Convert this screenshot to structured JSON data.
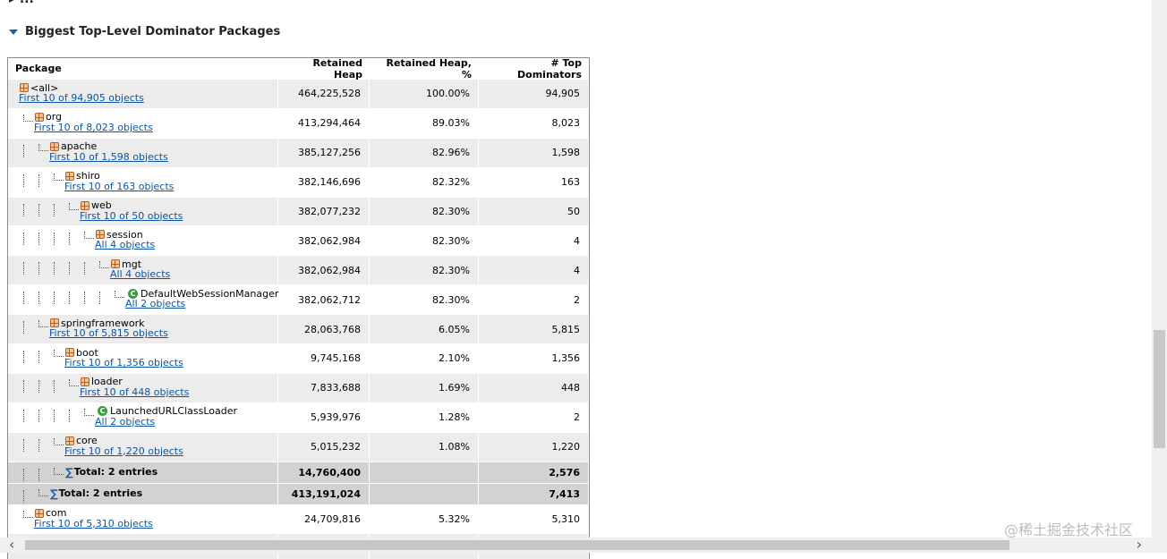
{
  "section": {
    "title": "Biggest Top-Level Dominator Packages"
  },
  "table": {
    "headers": [
      "Package",
      "Retained Heap",
      "Retained Heap, %",
      "# Top Dominators"
    ],
    "rows": [
      {
        "name": "<all>",
        "link": "First 10 of 94,905 objects",
        "heap": "464,225,528",
        "pct": "100.00%",
        "dom": "94,905",
        "depth": 0,
        "icon": "package",
        "shaded": true
      },
      {
        "name": "org",
        "link": "First 10 of 8,023 objects",
        "heap": "413,294,464",
        "pct": "89.03%",
        "dom": "8,023",
        "depth": 1,
        "icon": "package",
        "shaded": false
      },
      {
        "name": "apache",
        "link": "First 10 of 1,598 objects",
        "heap": "385,127,256",
        "pct": "82.96%",
        "dom": "1,598",
        "depth": 2,
        "icon": "package",
        "shaded": true
      },
      {
        "name": "shiro",
        "link": "First 10 of 163 objects",
        "heap": "382,146,696",
        "pct": "82.32%",
        "dom": "163",
        "depth": 3,
        "icon": "package",
        "shaded": false
      },
      {
        "name": "web",
        "link": "First 10 of 50 objects",
        "heap": "382,077,232",
        "pct": "82.30%",
        "dom": "50",
        "depth": 4,
        "icon": "package",
        "shaded": true
      },
      {
        "name": "session",
        "link": "All 4 objects",
        "heap": "382,062,984",
        "pct": "82.30%",
        "dom": "4",
        "depth": 5,
        "icon": "package",
        "shaded": false
      },
      {
        "name": "mgt",
        "link": "All 4 objects",
        "heap": "382,062,984",
        "pct": "82.30%",
        "dom": "4",
        "depth": 6,
        "icon": "package",
        "shaded": true
      },
      {
        "name": "DefaultWebSessionManager",
        "link": "All 2 objects",
        "heap": "382,062,712",
        "pct": "82.30%",
        "dom": "2",
        "depth": 7,
        "icon": "class",
        "shaded": false
      },
      {
        "name": "springframework",
        "link": "First 10 of 5,815 objects",
        "heap": "28,063,768",
        "pct": "6.05%",
        "dom": "5,815",
        "depth": 2,
        "icon": "package",
        "shaded": true
      },
      {
        "name": "boot",
        "link": "First 10 of 1,356 objects",
        "heap": "9,745,168",
        "pct": "2.10%",
        "dom": "1,356",
        "depth": 3,
        "icon": "package",
        "shaded": false
      },
      {
        "name": "loader",
        "link": "First 10 of 448 objects",
        "heap": "7,833,688",
        "pct": "1.69%",
        "dom": "448",
        "depth": 4,
        "icon": "package",
        "shaded": true
      },
      {
        "name": "LaunchedURLClassLoader",
        "link": "All 2 objects",
        "heap": "5,939,976",
        "pct": "1.28%",
        "dom": "2",
        "depth": 5,
        "icon": "class",
        "shaded": false
      },
      {
        "name": "core",
        "link": "First 10 of 1,220 objects",
        "heap": "5,015,232",
        "pct": "1.08%",
        "dom": "1,220",
        "depth": 3,
        "icon": "package",
        "shaded": true
      },
      {
        "name": "Total: 2 entries",
        "link": "",
        "heap": "14,760,400",
        "pct": "",
        "dom": "2,576",
        "depth": 3,
        "icon": "sigma",
        "total": true
      },
      {
        "name": "Total: 2 entries",
        "link": "",
        "heap": "413,191,024",
        "pct": "",
        "dom": "7,413",
        "depth": 2,
        "icon": "sigma",
        "total": true
      },
      {
        "name": "com",
        "link": "First 10 of 5,310 objects",
        "heap": "24,709,816",
        "pct": "5.32%",
        "dom": "5,310",
        "depth": 1,
        "icon": "package",
        "shaded": false
      },
      {
        "name": "",
        "link": "",
        "heap": "",
        "pct": "",
        "dom": "",
        "depth": 2,
        "icon": "package",
        "shaded": true
      }
    ]
  },
  "watermark": "@稀土掘金技术社区"
}
